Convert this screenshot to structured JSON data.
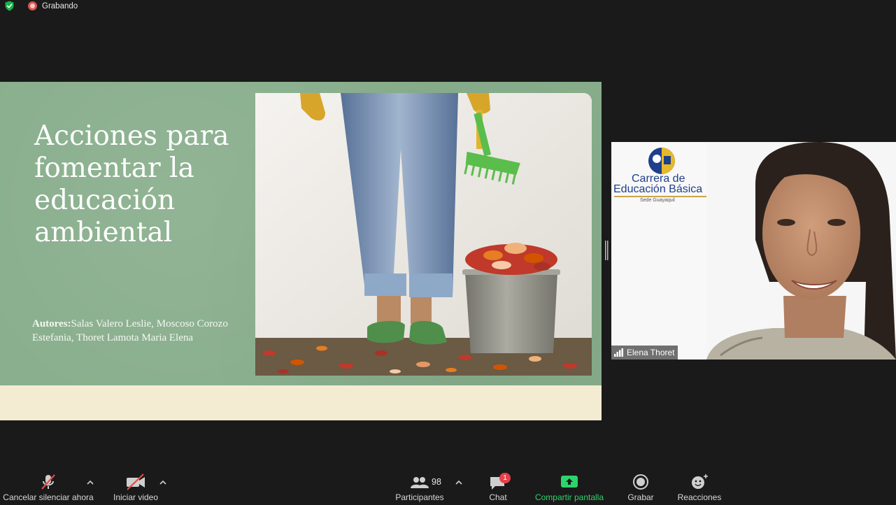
{
  "status": {
    "recording_label": "Grabando"
  },
  "slide": {
    "title": "Acciones para fomentar la educación ambiental",
    "authors_label": "Autores:",
    "authors": "Salas Valero Leslie, Moscoso Corozo Estefania, Thoret Lamota Maria Elena"
  },
  "participant": {
    "name": "Elena Thoret",
    "logo": {
      "line1": "Carrera de",
      "line2": "Educación Básica",
      "line3": "Sede Guayaquil"
    }
  },
  "toolbar": {
    "mute_label": "Cancelar silenciar ahora",
    "video_label": "Iniciar video",
    "participants_label": "Participantes",
    "participants_count": "98",
    "chat_label": "Chat",
    "chat_badge": "1",
    "share_label": "Compartir pantalla",
    "record_label": "Grabar",
    "reactions_label": "Reacciones"
  },
  "colors": {
    "slide_green": "#88ae8c",
    "slide_cream": "#f3ecd2",
    "share_green": "#2dd46b",
    "record_red": "#d9534f",
    "badge_red": "#e8404a"
  }
}
